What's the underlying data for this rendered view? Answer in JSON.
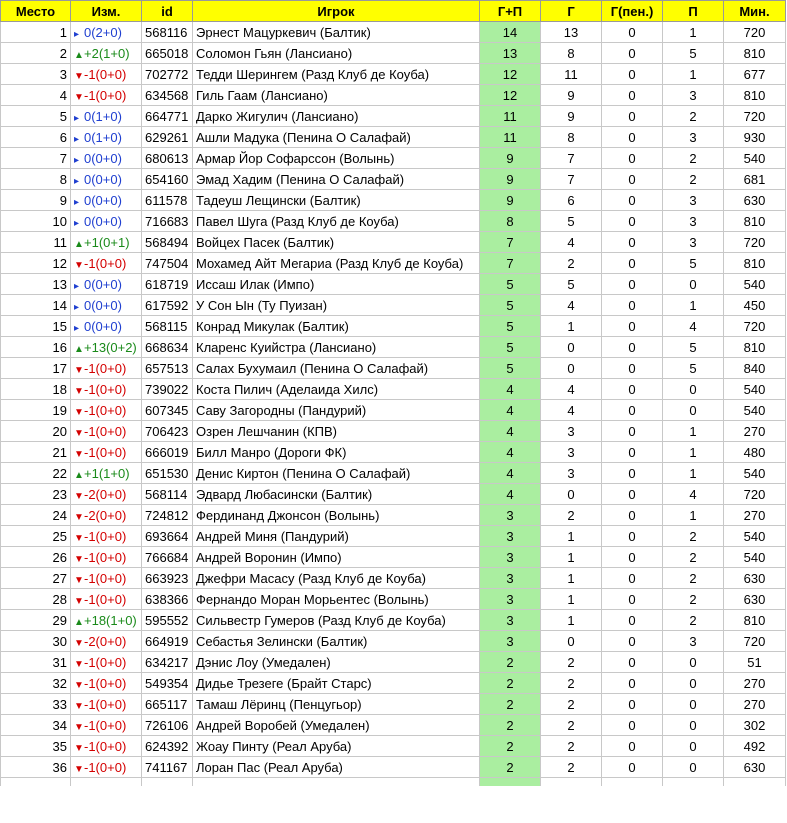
{
  "headers": {
    "place": "Место",
    "change": "Изм.",
    "id": "id",
    "player": "Игрок",
    "gp": "Г+П",
    "g": "Г",
    "gpen": "Г(пен.)",
    "p": "П",
    "min": "Мин."
  },
  "colors": {
    "header_bg": "#ffff00",
    "gp_bg": "#aaeea0",
    "up": "#1a8a1a",
    "down": "#d40000",
    "same": "#1f3fd0"
  },
  "rows": [
    {
      "place": "1",
      "dir": "same",
      "change": "0(2+0)",
      "id": "568116",
      "player": "Эрнест Мацуркевич (Балтик)",
      "gp": "14",
      "g": "13",
      "gpen": "0",
      "p": "1",
      "min": "720"
    },
    {
      "place": "2",
      "dir": "up",
      "change": "+2(1+0)",
      "id": "665018",
      "player": "Соломон Гьян (Лансиано)",
      "gp": "13",
      "g": "8",
      "gpen": "0",
      "p": "5",
      "min": "810"
    },
    {
      "place": "3",
      "dir": "down",
      "change": "-1(0+0)",
      "id": "702772",
      "player": "Тедди Шерингем (Разд Клуб де Коуба)",
      "gp": "12",
      "g": "11",
      "gpen": "0",
      "p": "1",
      "min": "677"
    },
    {
      "place": "4",
      "dir": "down",
      "change": "-1(0+0)",
      "id": "634568",
      "player": "Гиль Гаам (Лансиано)",
      "gp": "12",
      "g": "9",
      "gpen": "0",
      "p": "3",
      "min": "810"
    },
    {
      "place": "5",
      "dir": "same",
      "change": "0(1+0)",
      "id": "664771",
      "player": "Дарко Жигулич (Лансиано)",
      "gp": "11",
      "g": "9",
      "gpen": "0",
      "p": "2",
      "min": "720"
    },
    {
      "place": "6",
      "dir": "same",
      "change": "0(1+0)",
      "id": "629261",
      "player": "Ашли Мадука (Пенина О Салафай)",
      "gp": "11",
      "g": "8",
      "gpen": "0",
      "p": "3",
      "min": "930"
    },
    {
      "place": "7",
      "dir": "same",
      "change": "0(0+0)",
      "id": "680613",
      "player": "Армар Йор Софарссон (Волынь)",
      "gp": "9",
      "g": "7",
      "gpen": "0",
      "p": "2",
      "min": "540"
    },
    {
      "place": "8",
      "dir": "same",
      "change": "0(0+0)",
      "id": "654160",
      "player": "Эмад Хадим (Пенина О Салафай)",
      "gp": "9",
      "g": "7",
      "gpen": "0",
      "p": "2",
      "min": "681"
    },
    {
      "place": "9",
      "dir": "same",
      "change": "0(0+0)",
      "id": "611578",
      "player": "Тадеуш Лещински (Балтик)",
      "gp": "9",
      "g": "6",
      "gpen": "0",
      "p": "3",
      "min": "630"
    },
    {
      "place": "10",
      "dir": "same",
      "change": "0(0+0)",
      "id": "716683",
      "player": "Павел Шуга (Разд Клуб де Коуба)",
      "gp": "8",
      "g": "5",
      "gpen": "0",
      "p": "3",
      "min": "810"
    },
    {
      "place": "11",
      "dir": "up",
      "change": "+1(0+1)",
      "id": "568494",
      "player": "Войцех Пасек (Балтик)",
      "gp": "7",
      "g": "4",
      "gpen": "0",
      "p": "3",
      "min": "720"
    },
    {
      "place": "12",
      "dir": "down",
      "change": "-1(0+0)",
      "id": "747504",
      "player": "Мохамед Айт Мегариа (Разд Клуб де Коуба)",
      "gp": "7",
      "g": "2",
      "gpen": "0",
      "p": "5",
      "min": "810"
    },
    {
      "place": "13",
      "dir": "same",
      "change": "0(0+0)",
      "id": "618719",
      "player": "Иссаш Илак (Импо)",
      "gp": "5",
      "g": "5",
      "gpen": "0",
      "p": "0",
      "min": "540"
    },
    {
      "place": "14",
      "dir": "same",
      "change": "0(0+0)",
      "id": "617592",
      "player": "У Сон Ын (Ту Пуизан)",
      "gp": "5",
      "g": "4",
      "gpen": "0",
      "p": "1",
      "min": "450"
    },
    {
      "place": "15",
      "dir": "same",
      "change": "0(0+0)",
      "id": "568115",
      "player": "Конрад Микулак (Балтик)",
      "gp": "5",
      "g": "1",
      "gpen": "0",
      "p": "4",
      "min": "720"
    },
    {
      "place": "16",
      "dir": "up",
      "change": "+13(0+2)",
      "id": "668634",
      "player": "Кларенс Куийстра (Лансиано)",
      "gp": "5",
      "g": "0",
      "gpen": "0",
      "p": "5",
      "min": "810"
    },
    {
      "place": "17",
      "dir": "down",
      "change": "-1(0+0)",
      "id": "657513",
      "player": "Салах Бухумаил (Пенина О Салафай)",
      "gp": "5",
      "g": "0",
      "gpen": "0",
      "p": "5",
      "min": "840"
    },
    {
      "place": "18",
      "dir": "down",
      "change": "-1(0+0)",
      "id": "739022",
      "player": "Коста Пилич (Аделаида Хилс)",
      "gp": "4",
      "g": "4",
      "gpen": "0",
      "p": "0",
      "min": "540"
    },
    {
      "place": "19",
      "dir": "down",
      "change": "-1(0+0)",
      "id": "607345",
      "player": "Саву Загородны (Пандурий)",
      "gp": "4",
      "g": "4",
      "gpen": "0",
      "p": "0",
      "min": "540"
    },
    {
      "place": "20",
      "dir": "down",
      "change": "-1(0+0)",
      "id": "706423",
      "player": "Озрен Лешчанин (КПВ)",
      "gp": "4",
      "g": "3",
      "gpen": "0",
      "p": "1",
      "min": "270"
    },
    {
      "place": "21",
      "dir": "down",
      "change": "-1(0+0)",
      "id": "666019",
      "player": "Билл Манро (Дороги ФК)",
      "gp": "4",
      "g": "3",
      "gpen": "0",
      "p": "1",
      "min": "480"
    },
    {
      "place": "22",
      "dir": "up",
      "change": "+1(1+0)",
      "id": "651530",
      "player": "Денис Киртон (Пенина О Салафай)",
      "gp": "4",
      "g": "3",
      "gpen": "0",
      "p": "1",
      "min": "540"
    },
    {
      "place": "23",
      "dir": "down",
      "change": "-2(0+0)",
      "id": "568114",
      "player": "Эдвард Любасински (Балтик)",
      "gp": "4",
      "g": "0",
      "gpen": "0",
      "p": "4",
      "min": "720"
    },
    {
      "place": "24",
      "dir": "down",
      "change": "-2(0+0)",
      "id": "724812",
      "player": "Фердинанд Джонсон (Волынь)",
      "gp": "3",
      "g": "2",
      "gpen": "0",
      "p": "1",
      "min": "270"
    },
    {
      "place": "25",
      "dir": "down",
      "change": "-1(0+0)",
      "id": "693664",
      "player": "Андрей Миня (Пандурий)",
      "gp": "3",
      "g": "1",
      "gpen": "0",
      "p": "2",
      "min": "540"
    },
    {
      "place": "26",
      "dir": "down",
      "change": "-1(0+0)",
      "id": "766684",
      "player": "Андрей Воронин (Импо)",
      "gp": "3",
      "g": "1",
      "gpen": "0",
      "p": "2",
      "min": "540"
    },
    {
      "place": "27",
      "dir": "down",
      "change": "-1(0+0)",
      "id": "663923",
      "player": "Джефри Масасу (Разд Клуб де Коуба)",
      "gp": "3",
      "g": "1",
      "gpen": "0",
      "p": "2",
      "min": "630"
    },
    {
      "place": "28",
      "dir": "down",
      "change": "-1(0+0)",
      "id": "638366",
      "player": "Фернандо Моран Морьентес (Волынь)",
      "gp": "3",
      "g": "1",
      "gpen": "0",
      "p": "2",
      "min": "630"
    },
    {
      "place": "29",
      "dir": "up",
      "change": "+18(1+0)",
      "id": "595552",
      "player": "Сильвестр Гумеров (Разд Клуб де Коуба)",
      "gp": "3",
      "g": "1",
      "gpen": "0",
      "p": "2",
      "min": "810"
    },
    {
      "place": "30",
      "dir": "down",
      "change": "-2(0+0)",
      "id": "664919",
      "player": "Себастья Зелински (Балтик)",
      "gp": "3",
      "g": "0",
      "gpen": "0",
      "p": "3",
      "min": "720"
    },
    {
      "place": "31",
      "dir": "down",
      "change": "-1(0+0)",
      "id": "634217",
      "player": "Дэнис Лоу (Умедален)",
      "gp": "2",
      "g": "2",
      "gpen": "0",
      "p": "0",
      "min": "51"
    },
    {
      "place": "32",
      "dir": "down",
      "change": "-1(0+0)",
      "id": "549354",
      "player": "Дидье Трезеге (Брайт Старс)",
      "gp": "2",
      "g": "2",
      "gpen": "0",
      "p": "0",
      "min": "270"
    },
    {
      "place": "33",
      "dir": "down",
      "change": "-1(0+0)",
      "id": "665117",
      "player": "Тамаш Лёринц (Пенцугьор)",
      "gp": "2",
      "g": "2",
      "gpen": "0",
      "p": "0",
      "min": "270"
    },
    {
      "place": "34",
      "dir": "down",
      "change": "-1(0+0)",
      "id": "726106",
      "player": "Андрей Воробей (Умедален)",
      "gp": "2",
      "g": "2",
      "gpen": "0",
      "p": "0",
      "min": "302"
    },
    {
      "place": "35",
      "dir": "down",
      "change": "-1(0+0)",
      "id": "624392",
      "player": "Жоау Пинту (Реал Аруба)",
      "gp": "2",
      "g": "2",
      "gpen": "0",
      "p": "0",
      "min": "492"
    },
    {
      "place": "36",
      "dir": "down",
      "change": "-1(0+0)",
      "id": "741167",
      "player": "Лоран Пас (Реал Аруба)",
      "gp": "2",
      "g": "2",
      "gpen": "0",
      "p": "0",
      "min": "630"
    }
  ]
}
